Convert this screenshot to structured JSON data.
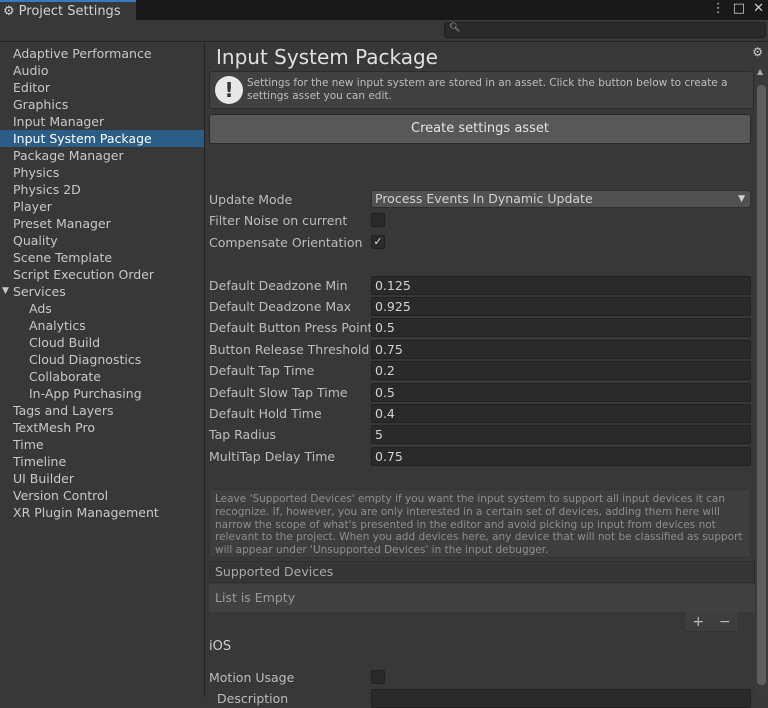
{
  "window": {
    "title": "Project Settings",
    "search_placeholder": ""
  },
  "sidebar": {
    "items": [
      {
        "label": "Adaptive Performance"
      },
      {
        "label": "Audio"
      },
      {
        "label": "Editor"
      },
      {
        "label": "Graphics"
      },
      {
        "label": "Input Manager"
      },
      {
        "label": "Input System Package",
        "selected": true
      },
      {
        "label": "Package Manager"
      },
      {
        "label": "Physics"
      },
      {
        "label": "Physics 2D"
      },
      {
        "label": "Player"
      },
      {
        "label": "Preset Manager"
      },
      {
        "label": "Quality"
      },
      {
        "label": "Scene Template"
      },
      {
        "label": "Script Execution Order"
      },
      {
        "label": "Services",
        "expanded": true
      },
      {
        "label": "Ads",
        "sub": true
      },
      {
        "label": "Analytics",
        "sub": true
      },
      {
        "label": "Cloud Build",
        "sub": true
      },
      {
        "label": "Cloud Diagnostics",
        "sub": true
      },
      {
        "label": "Collaborate",
        "sub": true
      },
      {
        "label": "In-App Purchasing",
        "sub": true
      },
      {
        "label": "Tags and Layers"
      },
      {
        "label": "TextMesh Pro"
      },
      {
        "label": "Time"
      },
      {
        "label": "Timeline"
      },
      {
        "label": "UI Builder"
      },
      {
        "label": "Version Control"
      },
      {
        "label": "XR Plugin Management"
      }
    ]
  },
  "main": {
    "title": "Input System Package",
    "help_text": "Settings for the new input system are stored in an asset. Click the button below to create a settings asset you can edit.",
    "create_button": "Create settings asset",
    "update_mode": {
      "label": "Update Mode",
      "value": "Process Events In Dynamic Update"
    },
    "filter_noise": {
      "label": "Filter Noise on current",
      "checked": false
    },
    "compensate": {
      "label": "Compensate Orientation",
      "checked": true,
      "mark": "✓"
    },
    "fields": [
      {
        "label": "Default Deadzone Min",
        "value": "0.125"
      },
      {
        "label": "Default Deadzone Max",
        "value": "0.925"
      },
      {
        "label": "Default Button Press Point",
        "value": "0.5"
      },
      {
        "label": "Button Release Threshold",
        "value": "0.75"
      },
      {
        "label": "Default Tap Time",
        "value": "0.2"
      },
      {
        "label": "Default Slow Tap Time",
        "value": "0.5"
      },
      {
        "label": "Default Hold Time",
        "value": "0.4"
      },
      {
        "label": "Tap Radius",
        "value": "5"
      },
      {
        "label": "MultiTap Delay Time",
        "value": "0.75"
      }
    ],
    "devices_info": "Leave 'Supported Devices' empty if you want the input system to support all input devices it can recognize. If, however, you are only interested in a certain set of devices, adding them here will narrow the scope of what's presented in the editor and avoid picking up input from devices not relevant to the project. When you add devices here, any device that will not be classified as support will appear under 'Unsupported Devices' in the input debugger.",
    "supported_devices": "Supported Devices",
    "list_empty": "List is Empty",
    "add": "+",
    "remove": "−",
    "ios_header": "iOS",
    "motion_usage": {
      "label": "Motion Usage",
      "checked": false
    },
    "description_label": "Description"
  }
}
